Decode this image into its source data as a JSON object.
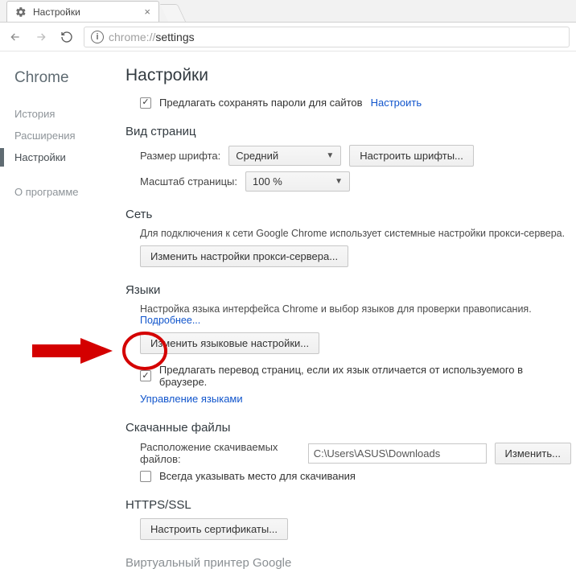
{
  "tab": {
    "title": "Настройки"
  },
  "address": {
    "scheme": "chrome://",
    "path": "settings"
  },
  "sidebar": {
    "brand": "Chrome",
    "items": [
      {
        "label": "История"
      },
      {
        "label": "Расширения"
      },
      {
        "label": "Настройки"
      }
    ],
    "about": "О программе"
  },
  "content": {
    "title": "Настройки",
    "passwords": {
      "label": "Предлагать сохранять пароли для сайтов",
      "link": "Настроить"
    },
    "appearance": {
      "section": "Вид страниц",
      "font_label": "Размер шрифта:",
      "font_value": "Средний",
      "font_btn": "Настроить шрифты...",
      "zoom_label": "Масштаб страницы:",
      "zoom_value": "100 %"
    },
    "network": {
      "section": "Сеть",
      "help": "Для подключения к сети Google Chrome использует системные настройки прокси-сервера.",
      "btn": "Изменить настройки прокси-сервера..."
    },
    "languages": {
      "section": "Языки",
      "help": "Настройка языка интерфейса Chrome и выбор языков для проверки правописания.",
      "help_link": "Подробнее...",
      "btn": "Изменить языковые настройки...",
      "translate": "Предлагать перевод страниц, если их язык отличается от используемого в браузере.",
      "manage": "Управление языками"
    },
    "downloads": {
      "section": "Скачанные файлы",
      "loc_label": "Расположение скачиваемых файлов:",
      "loc_value": "C:\\Users\\ASUS\\Downloads",
      "change": "Изменить...",
      "ask": "Всегда указывать место для скачивания"
    },
    "https": {
      "section": "HTTPS/SSL",
      "btn": "Настроить сертификаты..."
    },
    "printer": {
      "section": "Виртуальный принтер Google"
    }
  }
}
